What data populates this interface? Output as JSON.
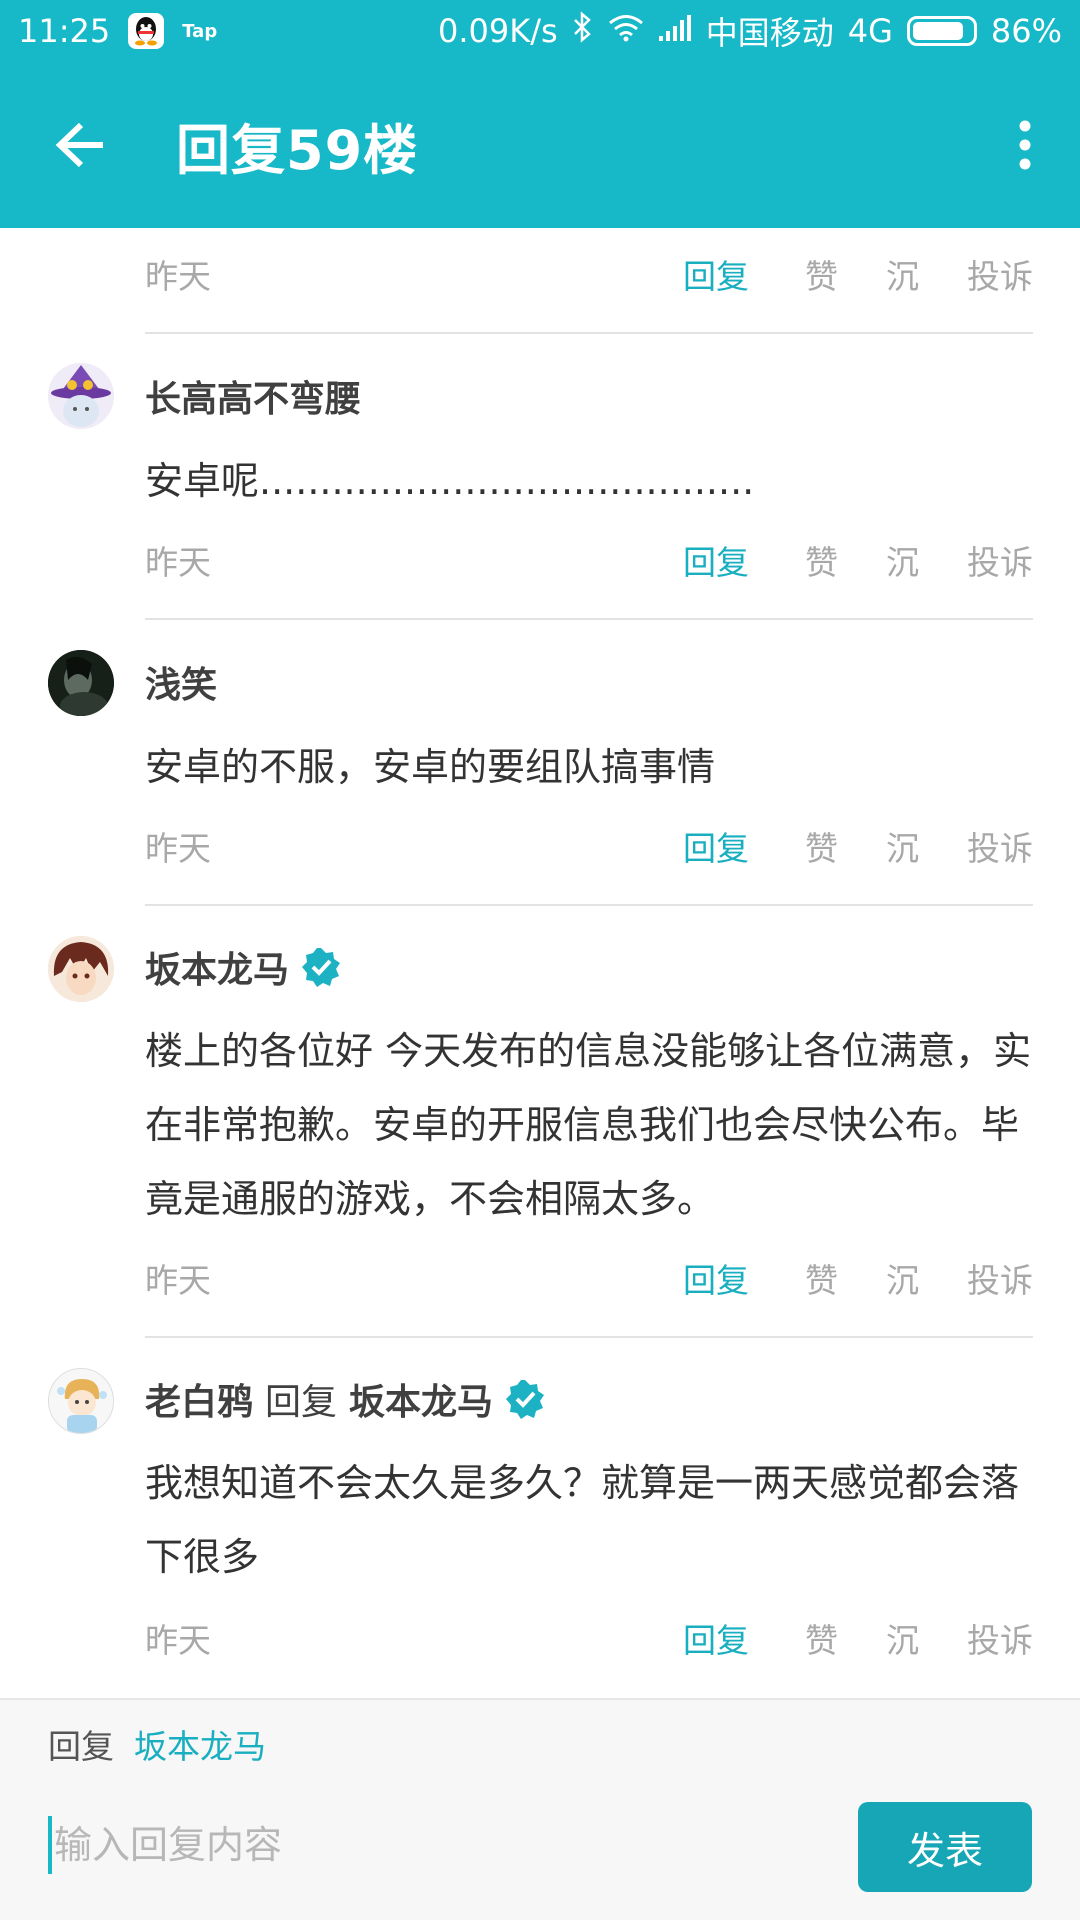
{
  "status_bar": {
    "time": "11:25",
    "tap_icon_text": "Tap",
    "net_speed": "0.09K/s",
    "carrier": "中国移动",
    "network": "4G",
    "battery": "86%",
    "battery_level": 0.86
  },
  "app_bar": {
    "title": "回复59楼"
  },
  "colors": {
    "accent": "#17b8c7",
    "link": "#19aec0",
    "send_button": "#16a6b6"
  },
  "actions": {
    "reply": "回复",
    "like": "赞",
    "sink": "沉",
    "report": "投诉"
  },
  "top_row": {
    "time": "昨天"
  },
  "comments": [
    {
      "name": "长高高不弯腰",
      "text": "安卓呢.........................................",
      "time": "昨天",
      "avatar_icon": "wizard-cat-avatar"
    },
    {
      "name": "浅笑",
      "text": "安卓的不服，安卓的要组队搞事情",
      "time": "昨天",
      "avatar_icon": "dark-portrait-avatar"
    },
    {
      "name": "坂本龙马",
      "verified": true,
      "text": "楼上的各位好 今天发布的信息没能够让各位满意，实在非常抱歉。安卓的开服信息我们也会尽快公布。毕竟是通服的游戏，不会相隔太多。",
      "time": "昨天",
      "avatar_icon": "anime-boy-avatar"
    },
    {
      "name": "老白鸦",
      "reply_word": "回复",
      "reply_target": "坂本龙马",
      "target_verified": true,
      "text": "我想知道不会太久是多久？就算是一两天感觉都会落下很多",
      "time": "昨天",
      "avatar_icon": "chibi-avatar"
    }
  ],
  "bottom_bar": {
    "reply_label": "回复",
    "reply_target": "坂本龙马",
    "input_placeholder": "输入回复内容",
    "send_label": "发表"
  }
}
